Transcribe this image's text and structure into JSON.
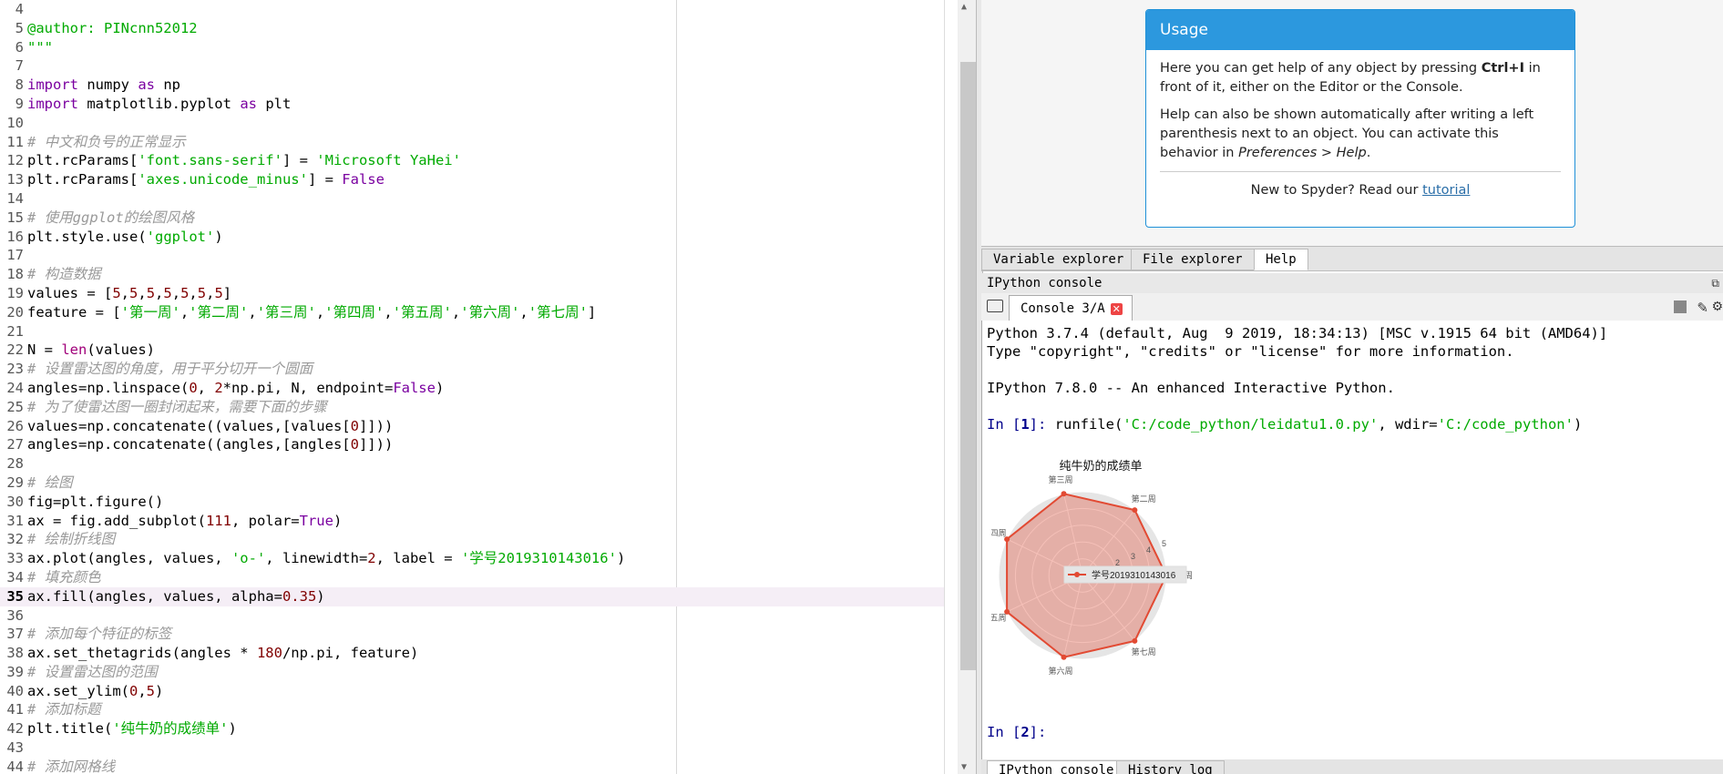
{
  "editor": {
    "current_line": 35,
    "lines": [
      {
        "n": "4",
        "tokens": []
      },
      {
        "n": "5",
        "tokens": [
          {
            "c": "str",
            "t": "@author: PINcnn52012"
          }
        ]
      },
      {
        "n": "6",
        "tokens": [
          {
            "c": "str",
            "t": "\"\"\""
          }
        ]
      },
      {
        "n": "7",
        "tokens": []
      },
      {
        "n": "8",
        "tokens": [
          {
            "c": "kw",
            "t": "import"
          },
          {
            "c": "",
            "t": " numpy "
          },
          {
            "c": "kw",
            "t": "as"
          },
          {
            "c": "",
            "t": " np"
          }
        ]
      },
      {
        "n": "9",
        "tokens": [
          {
            "c": "kw",
            "t": "import"
          },
          {
            "c": "",
            "t": " matplotlib.pyplot "
          },
          {
            "c": "kw",
            "t": "as"
          },
          {
            "c": "",
            "t": " plt"
          }
        ]
      },
      {
        "n": "10",
        "tokens": []
      },
      {
        "n": "11",
        "tokens": [
          {
            "c": "cm",
            "t": "# 中文和负号的正常显示"
          }
        ]
      },
      {
        "n": "12",
        "tokens": [
          {
            "c": "",
            "t": "plt.rcParams["
          },
          {
            "c": "str",
            "t": "'font.sans-serif'"
          },
          {
            "c": "",
            "t": "] = "
          },
          {
            "c": "str",
            "t": "'Microsoft YaHei'"
          }
        ]
      },
      {
        "n": "13",
        "tokens": [
          {
            "c": "",
            "t": "plt.rcParams["
          },
          {
            "c": "str",
            "t": "'axes.unicode_minus'"
          },
          {
            "c": "",
            "t": "] = "
          },
          {
            "c": "kw",
            "t": "False"
          }
        ]
      },
      {
        "n": "14",
        "tokens": []
      },
      {
        "n": "15",
        "tokens": [
          {
            "c": "cm",
            "t": "# 使用ggplot的绘图风格"
          }
        ]
      },
      {
        "n": "16",
        "tokens": [
          {
            "c": "",
            "t": "plt.style.use("
          },
          {
            "c": "str",
            "t": "'ggplot'"
          },
          {
            "c": "",
            "t": ")"
          }
        ]
      },
      {
        "n": "17",
        "tokens": []
      },
      {
        "n": "18",
        "tokens": [
          {
            "c": "cm",
            "t": "# 构造数据"
          }
        ]
      },
      {
        "n": "19",
        "tokens": [
          {
            "c": "",
            "t": "values = ["
          },
          {
            "c": "num",
            "t": "5"
          },
          {
            "c": "",
            "t": ","
          },
          {
            "c": "num",
            "t": "5"
          },
          {
            "c": "",
            "t": ","
          },
          {
            "c": "num",
            "t": "5"
          },
          {
            "c": "",
            "t": ","
          },
          {
            "c": "num",
            "t": "5"
          },
          {
            "c": "",
            "t": ","
          },
          {
            "c": "num",
            "t": "5"
          },
          {
            "c": "",
            "t": ","
          },
          {
            "c": "num",
            "t": "5"
          },
          {
            "c": "",
            "t": ","
          },
          {
            "c": "num",
            "t": "5"
          },
          {
            "c": "",
            "t": "]"
          }
        ]
      },
      {
        "n": "20",
        "tokens": [
          {
            "c": "",
            "t": "feature = ["
          },
          {
            "c": "str",
            "t": "'第一周'"
          },
          {
            "c": "",
            "t": ","
          },
          {
            "c": "str",
            "t": "'第二周'"
          },
          {
            "c": "",
            "t": ","
          },
          {
            "c": "str",
            "t": "'第三周'"
          },
          {
            "c": "",
            "t": ","
          },
          {
            "c": "str",
            "t": "'第四周'"
          },
          {
            "c": "",
            "t": ","
          },
          {
            "c": "str",
            "t": "'第五周'"
          },
          {
            "c": "",
            "t": ","
          },
          {
            "c": "str",
            "t": "'第六周'"
          },
          {
            "c": "",
            "t": ","
          },
          {
            "c": "str",
            "t": "'第七周'"
          },
          {
            "c": "",
            "t": "]"
          }
        ]
      },
      {
        "n": "21",
        "tokens": []
      },
      {
        "n": "22",
        "tokens": [
          {
            "c": "",
            "t": "N = "
          },
          {
            "c": "fn",
            "t": "len"
          },
          {
            "c": "",
            "t": "(values)"
          }
        ]
      },
      {
        "n": "23",
        "tokens": [
          {
            "c": "cm",
            "t": "# 设置雷达图的角度，用于平分切开一个圆面"
          }
        ]
      },
      {
        "n": "24",
        "tokens": [
          {
            "c": "",
            "t": "angles=np.linspace("
          },
          {
            "c": "num",
            "t": "0"
          },
          {
            "c": "",
            "t": ", "
          },
          {
            "c": "num",
            "t": "2"
          },
          {
            "c": "",
            "t": "*np.pi, N, endpoint="
          },
          {
            "c": "kw",
            "t": "False"
          },
          {
            "c": "",
            "t": ")"
          }
        ]
      },
      {
        "n": "25",
        "tokens": [
          {
            "c": "cm",
            "t": "# 为了使雷达图一圈封闭起来，需要下面的步骤"
          }
        ]
      },
      {
        "n": "26",
        "tokens": [
          {
            "c": "",
            "t": "values=np.concatenate((values,[values["
          },
          {
            "c": "num",
            "t": "0"
          },
          {
            "c": "",
            "t": "]]))"
          }
        ]
      },
      {
        "n": "27",
        "tokens": [
          {
            "c": "",
            "t": "angles=np.concatenate((angles,[angles["
          },
          {
            "c": "num",
            "t": "0"
          },
          {
            "c": "",
            "t": "]]))"
          }
        ]
      },
      {
        "n": "28",
        "tokens": []
      },
      {
        "n": "29",
        "tokens": [
          {
            "c": "cm",
            "t": "# 绘图"
          }
        ]
      },
      {
        "n": "30",
        "tokens": [
          {
            "c": "",
            "t": "fig=plt.figure()"
          }
        ]
      },
      {
        "n": "31",
        "tokens": [
          {
            "c": "",
            "t": "ax = fig.add_subplot("
          },
          {
            "c": "num",
            "t": "111"
          },
          {
            "c": "",
            "t": ", polar="
          },
          {
            "c": "kw",
            "t": "True"
          },
          {
            "c": "",
            "t": ")"
          }
        ]
      },
      {
        "n": "32",
        "tokens": [
          {
            "c": "cm",
            "t": "# 绘制折线图"
          }
        ]
      },
      {
        "n": "33",
        "tokens": [
          {
            "c": "",
            "t": "ax.plot(angles, values, "
          },
          {
            "c": "str",
            "t": "'o-'"
          },
          {
            "c": "",
            "t": ", linewidth="
          },
          {
            "c": "num",
            "t": "2"
          },
          {
            "c": "",
            "t": ", label = "
          },
          {
            "c": "str",
            "t": "'学号2019310143016'"
          },
          {
            "c": "",
            "t": ")"
          }
        ]
      },
      {
        "n": "34",
        "tokens": [
          {
            "c": "cm",
            "t": "# 填充颜色"
          }
        ]
      },
      {
        "n": "35",
        "tokens": [
          {
            "c": "",
            "t": "ax.fill(angles, values, alpha="
          },
          {
            "c": "num",
            "t": "0.35"
          },
          {
            "c": "",
            "t": ")"
          }
        ]
      },
      {
        "n": "36",
        "tokens": []
      },
      {
        "n": "37",
        "tokens": [
          {
            "c": "cm",
            "t": "# 添加每个特征的标签"
          }
        ]
      },
      {
        "n": "38",
        "tokens": [
          {
            "c": "",
            "t": "ax.set_thetagrids(angles * "
          },
          {
            "c": "num",
            "t": "180"
          },
          {
            "c": "",
            "t": "/np.pi, feature)"
          }
        ]
      },
      {
        "n": "39",
        "tokens": [
          {
            "c": "cm",
            "t": "# 设置雷达图的范围"
          }
        ]
      },
      {
        "n": "40",
        "tokens": [
          {
            "c": "",
            "t": "ax.set_ylim("
          },
          {
            "c": "num",
            "t": "0"
          },
          {
            "c": "",
            "t": ","
          },
          {
            "c": "num",
            "t": "5"
          },
          {
            "c": "",
            "t": ")"
          }
        ]
      },
      {
        "n": "41",
        "tokens": [
          {
            "c": "cm",
            "t": "# 添加标题"
          }
        ]
      },
      {
        "n": "42",
        "tokens": [
          {
            "c": "",
            "t": "plt.title("
          },
          {
            "c": "str",
            "t": "'纯牛奶的成绩单'"
          },
          {
            "c": "",
            "t": ")"
          }
        ]
      },
      {
        "n": "43",
        "tokens": []
      },
      {
        "n": "44",
        "tokens": [
          {
            "c": "cm",
            "t": "# 添加网格线"
          }
        ]
      }
    ]
  },
  "help": {
    "usage_title": "Usage",
    "p1_pre": "Here you can get help of any object by pressing ",
    "p1_key": "Ctrl+I",
    "p1_post": " in front of it, either on the Editor or the Console.",
    "p2_pre": "Help can also be shown automatically after writing a left parenthesis next to an object. You can activate this behavior in ",
    "p2_path": "Preferences > Help",
    "p2_post": ".",
    "footer_pre": "New to Spyder? Read our ",
    "footer_link": "tutorial"
  },
  "top_tabs": [
    "Variable explorer",
    "File explorer",
    "Help"
  ],
  "ipython_header": "IPython console",
  "console_tab_label": "Console 3/A",
  "console": {
    "line1": "Python 3.7.4 (default, Aug  9 2019, 18:34:13) [MSC v.1915 64 bit (AMD64)]",
    "line2": "Type \"copyright\", \"credits\" or \"license\" for more information.",
    "line3": "IPython 7.8.0 -- An enhanced Interactive Python.",
    "prompt1_in": "In [",
    "prompt1_num": "1",
    "prompt1_close": "]:",
    "run_pre": " runfile(",
    "run_path": "'C:/code_python/leidatu1.0.py'",
    "run_mid": ", wdir=",
    "run_wdir": "'C:/code_python'",
    "run_end": ")",
    "prompt2_in": "In [",
    "prompt2_num": "2",
    "prompt2_close": "]:"
  },
  "bottom_tabs": [
    "IPython console",
    "History log"
  ],
  "chart_data": {
    "type": "radar",
    "title": "纯牛奶的成绩单",
    "categories": [
      "第一周",
      "第二周",
      "第三周",
      "第四周",
      "第五周",
      "第六周",
      "第七周"
    ],
    "series": [
      {
        "name": "学号2019310143016",
        "values": [
          5,
          5,
          5,
          5,
          5,
          5,
          5
        ]
      }
    ],
    "ylim": [
      0,
      5
    ],
    "radial_ticks": [
      "1",
      "2",
      "3",
      "4",
      "5"
    ],
    "legend_position": "center",
    "colors": {
      "line": "#e24a33",
      "fill": "#e24a33",
      "background": "#e5e5e5",
      "grid": "#ffffff"
    }
  }
}
